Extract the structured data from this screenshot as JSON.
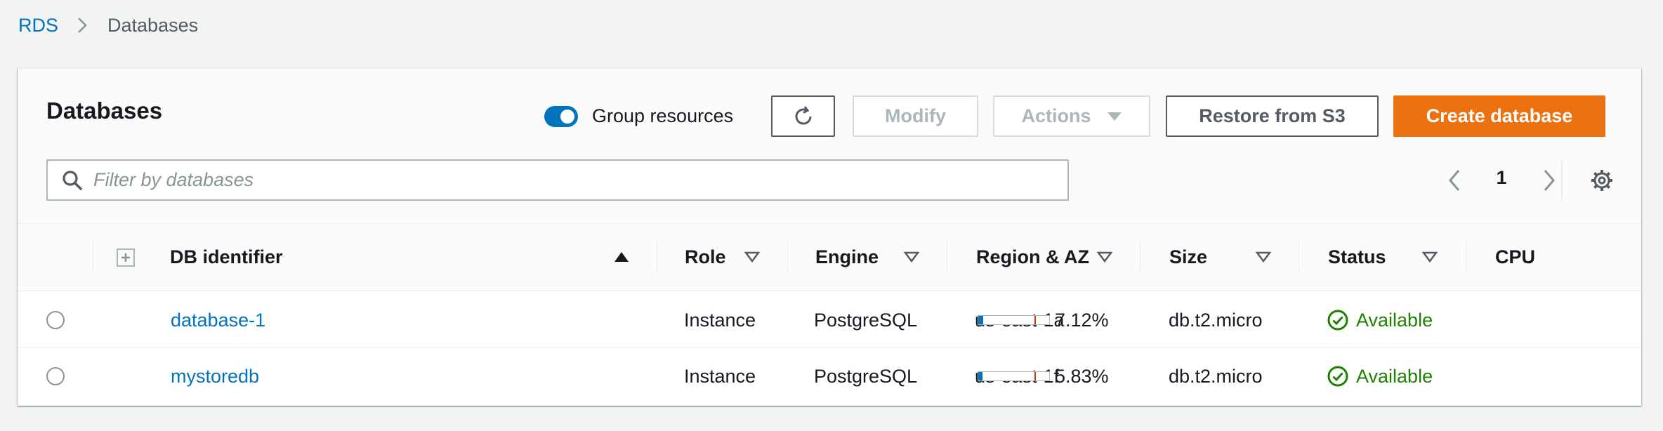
{
  "breadcrumb": {
    "root": "RDS",
    "current": "Databases"
  },
  "panel": {
    "title": "Databases",
    "group_toggle": {
      "label": "Group resources",
      "enabled": true
    },
    "buttons": {
      "modify": "Modify",
      "actions": "Actions",
      "restore": "Restore from S3",
      "create": "Create database"
    },
    "filter": {
      "placeholder": "Filter by databases",
      "value": ""
    },
    "pagination": {
      "page": "1"
    }
  },
  "table": {
    "columns": {
      "db_identifier": "DB identifier",
      "role": "Role",
      "engine": "Engine",
      "region": "Region & AZ",
      "size": "Size",
      "status": "Status",
      "cpu": "CPU"
    },
    "rows": [
      {
        "db_identifier": "database-1",
        "role": "Instance",
        "engine": "PostgreSQL",
        "region": "us-east-1a",
        "size": "db.t2.micro",
        "status": "Available",
        "cpu": "7.12%",
        "cpu_value": 7.12
      },
      {
        "db_identifier": "mystoredb",
        "role": "Instance",
        "engine": "PostgreSQL",
        "region": "us-east-1f",
        "size": "db.t2.micro",
        "status": "Available",
        "cpu": "5.83%",
        "cpu_value": 5.83
      }
    ]
  },
  "colors": {
    "link": "#0073bb",
    "primary": "#ec7211",
    "status_ok": "#1d8102",
    "cpu_threshold": "#d13212"
  }
}
